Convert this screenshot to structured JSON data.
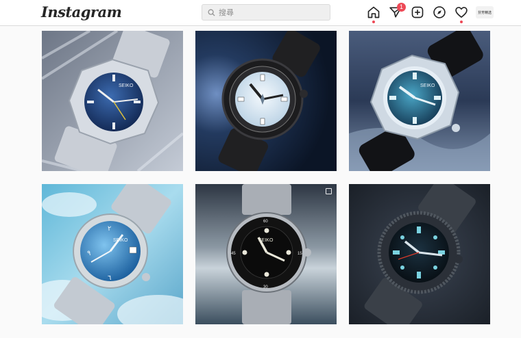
{
  "header": {
    "logo": "Instagram",
    "search_placeholder": "搜尋",
    "notification_count": "1",
    "profile_label": "芬芳精选"
  },
  "nav": {
    "items": [
      "home-icon",
      "direct-icon",
      "new-post-icon",
      "explore-icon",
      "activity-icon"
    ]
  },
  "posts": [
    {
      "subject": "blue dial dress watch",
      "brand": "SEIKO",
      "colors": {
        "bg": "#9aa3b2",
        "dial": "#1f3f7a",
        "case": "#c9ced6"
      }
    },
    {
      "subject": "white dial black diver watch",
      "brand": "",
      "colors": {
        "bg": "#17263f",
        "dial": "#dfeaf4",
        "case": "#1a1a1a"
      }
    },
    {
      "subject": "teal dial cushion diver watch",
      "brand": "SEIKO",
      "colors": {
        "bg": "#2c3c58",
        "dial": "#2f7f9e",
        "case": "#d2dbe4"
      }
    },
    {
      "subject": "blue dial watch on clouds",
      "brand": "SEIKO",
      "colors": {
        "bg": "#86c8e0",
        "dial": "#2d7fc0",
        "case": "#cfd6dc"
      }
    },
    {
      "subject": "black dial submariner style watch",
      "brand": "SEIKO",
      "colors": {
        "bg": "#2a3340",
        "dial": "#111111",
        "case": "#b8bcc2"
      }
    },
    {
      "subject": "black dial textured bezel watch",
      "brand": "",
      "colors": {
        "bg": "#252c36",
        "dial": "#0e1a22",
        "case": "#3c434c"
      }
    }
  ]
}
